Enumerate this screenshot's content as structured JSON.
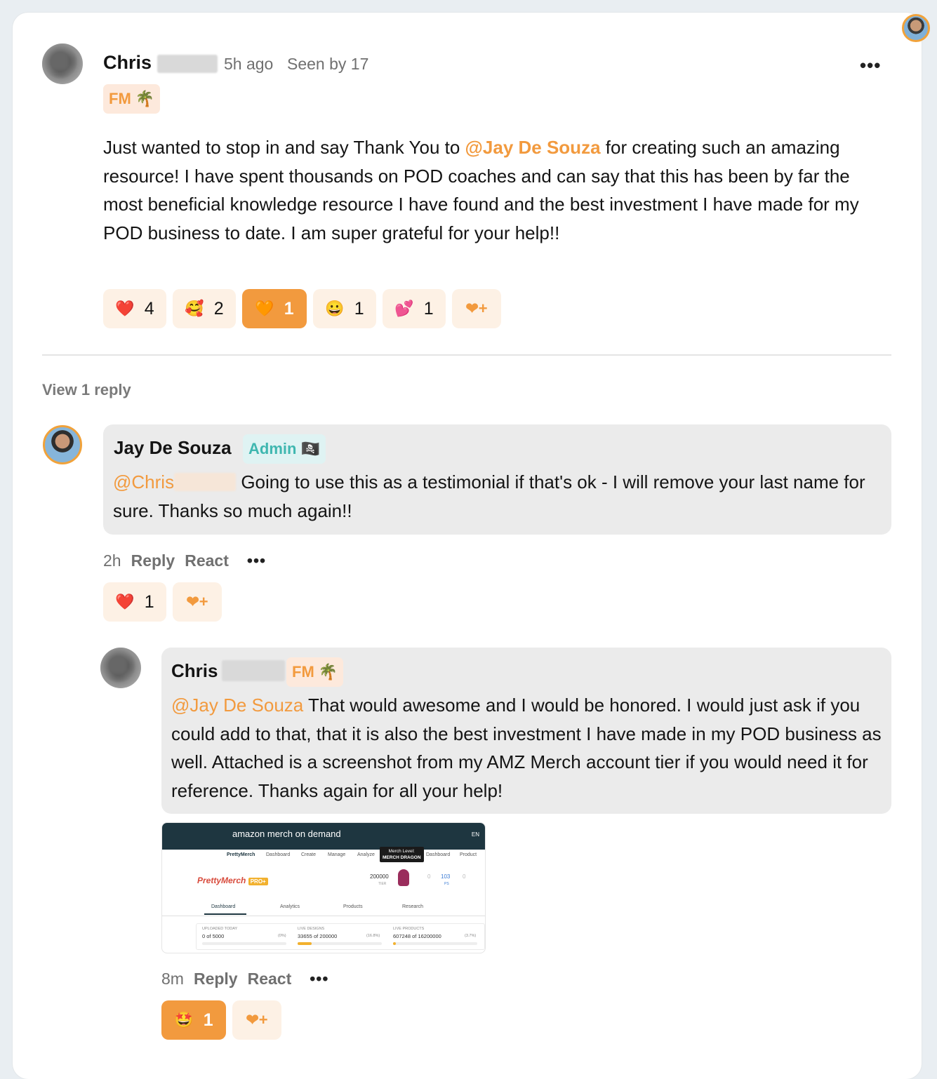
{
  "post": {
    "author_first": "Chris",
    "time": "5h ago",
    "seen": "Seen by 17",
    "tag": "FM 🌴",
    "more": "•••",
    "text_before": "Just wanted to stop in and say Thank You to ",
    "mention": "@Jay De Souza",
    "text_after": " for creating such an amazing resource! I have spent thousands on POD coaches and can say that this has been by far the most beneficial knowledge resource I have found and the best investment I have made for my POD business to date. I am super grateful for your help!!",
    "reactions": [
      {
        "emoji": "❤️",
        "count": "4",
        "active": false
      },
      {
        "emoji": "🥰",
        "count": "2",
        "active": false
      },
      {
        "emoji": "🧡",
        "count": "1",
        "active": true
      },
      {
        "emoji": "😀",
        "count": "1",
        "active": false
      },
      {
        "emoji": "💕",
        "count": "1",
        "active": false
      }
    ],
    "add_reaction_icon": "❤+"
  },
  "view_replies": "View 1 reply",
  "reply1": {
    "author": "Jay De Souza",
    "tag": "Admin 🏴‍☠️",
    "mention": "@Chris",
    "text": "Going to use this as a testimonial if that's ok - I will remove your last name for sure. Thanks so much again!!",
    "time": "2h",
    "reply_label": "Reply",
    "react_label": "React",
    "more": "•••",
    "reactions": [
      {
        "emoji": "❤️",
        "count": "1",
        "active": false
      }
    ],
    "add_reaction_icon": "❤+"
  },
  "reply2": {
    "author_first": "Chris",
    "tag": "FM 🌴",
    "mention": "@Jay De Souza",
    "text": " That would awesome and I would be honored. I would just ask if you could add to that, that it is also the best investment I have made in my POD business as well. Attached is a screenshot from my AMZ Merch account tier if you would need it for reference. Thanks again for all your help!",
    "time": "8m",
    "reply_label": "Reply",
    "react_label": "React",
    "more": "•••",
    "reactions": [
      {
        "emoji": "🤩",
        "count": "1",
        "active": true
      }
    ],
    "add_reaction_icon": "❤+",
    "attachment": {
      "brand": "amazon merch on demand",
      "lang": "EN",
      "nav": [
        "PrettyMerch",
        "Dashboard",
        "Create",
        "Manage",
        "Analyze",
        "Dashboard",
        "Product"
      ],
      "tooltip_line1": "Merch Level:",
      "tooltip_line2": "MERCH DRAGON",
      "logo": "PrettyMerch",
      "pro": "PRO+",
      "tier_value": "200000",
      "tier_label": "TIER",
      "ps_value": "103",
      "ps_label": "PS",
      "zero": "0",
      "tabs": [
        "Dashboard",
        "Analytics",
        "Products",
        "Research"
      ],
      "stats": [
        {
          "label": "UPLOADED TODAY",
          "value": "0 of 5000",
          "pct": "(0%)",
          "fill": 0
        },
        {
          "label": "LIVE DESIGNS",
          "value": "33655 of 200000",
          "pct": "(16.8%)",
          "fill": 0.168
        },
        {
          "label": "LIVE PRODUCTS",
          "value": "607248 of 16200000",
          "pct": "(3.7%)",
          "fill": 0.037
        }
      ]
    }
  }
}
